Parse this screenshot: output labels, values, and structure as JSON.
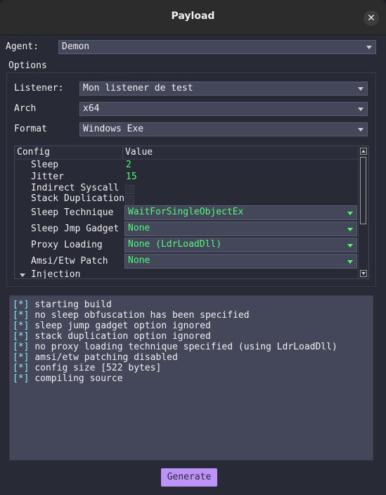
{
  "window": {
    "title": "Payload",
    "close_glyph": "✕"
  },
  "agent": {
    "label": "Agent:",
    "value": "Demon"
  },
  "options": {
    "title": "Options",
    "listener": {
      "label": "Listener:",
      "value": "Mon listener de test"
    },
    "arch": {
      "label": "Arch",
      "value": "x64"
    },
    "format": {
      "label": "Format",
      "value": "Windows Exe"
    }
  },
  "config": {
    "headers": {
      "config": "Config",
      "value": "Value"
    },
    "sleep": {
      "key": "Sleep",
      "value": "2"
    },
    "jitter": {
      "key": "Jitter",
      "value": "15"
    },
    "indirect_syscall": {
      "key": "Indirect Syscall"
    },
    "stack_duplication": {
      "key": "Stack Duplication"
    },
    "sleep_technique": {
      "key": "Sleep Technique",
      "value": "WaitForSingleObjectEx"
    },
    "sleep_jmp_gadget": {
      "key": "Sleep Jmp Gadget",
      "value": "None"
    },
    "proxy_loading": {
      "key": "Proxy Loading",
      "value": "None (LdrLoadDll)"
    },
    "amsi_etw_patch": {
      "key": "Amsi/Etw Patch",
      "value": "None"
    },
    "injection": {
      "key": "Injection"
    }
  },
  "console": {
    "tag": "[*]",
    "lines": [
      "starting build",
      "no sleep obfuscation has been specified",
      "sleep jump gadget option ignored",
      "stack duplication option ignored",
      "no proxy loading technique specified (using LdrLoadDll)",
      "amsi/etw patching disabled",
      "config size [522 bytes]",
      "compiling source"
    ]
  },
  "generate_label": "Generate",
  "colors": {
    "background": "#282a36",
    "field": "#44475a",
    "green": "#50fa7b",
    "cyan": "#8be9fd",
    "button": "#bd93f9"
  }
}
